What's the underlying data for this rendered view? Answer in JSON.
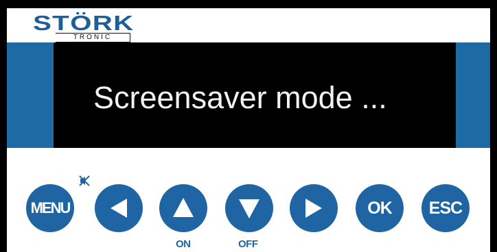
{
  "logo": {
    "brand": "STÖRK",
    "sub": "TRONIC"
  },
  "display": {
    "message": "Screensaver mode ..."
  },
  "buttons": {
    "menu": "MENU",
    "ok": "OK",
    "esc": "ESC"
  },
  "labels": {
    "on": "ON",
    "off": "OFF"
  },
  "icons": {
    "mute": "speaker-muted-icon",
    "left": "triangle-left-icon",
    "up": "triangle-up-icon",
    "down": "triangle-down-icon",
    "right": "triangle-right-icon"
  },
  "colors": {
    "frame": "#000000",
    "panel": "#ffffff",
    "accent": "#1f65a3",
    "display_bg": "#000000",
    "display_text": "#f2f2f2"
  }
}
